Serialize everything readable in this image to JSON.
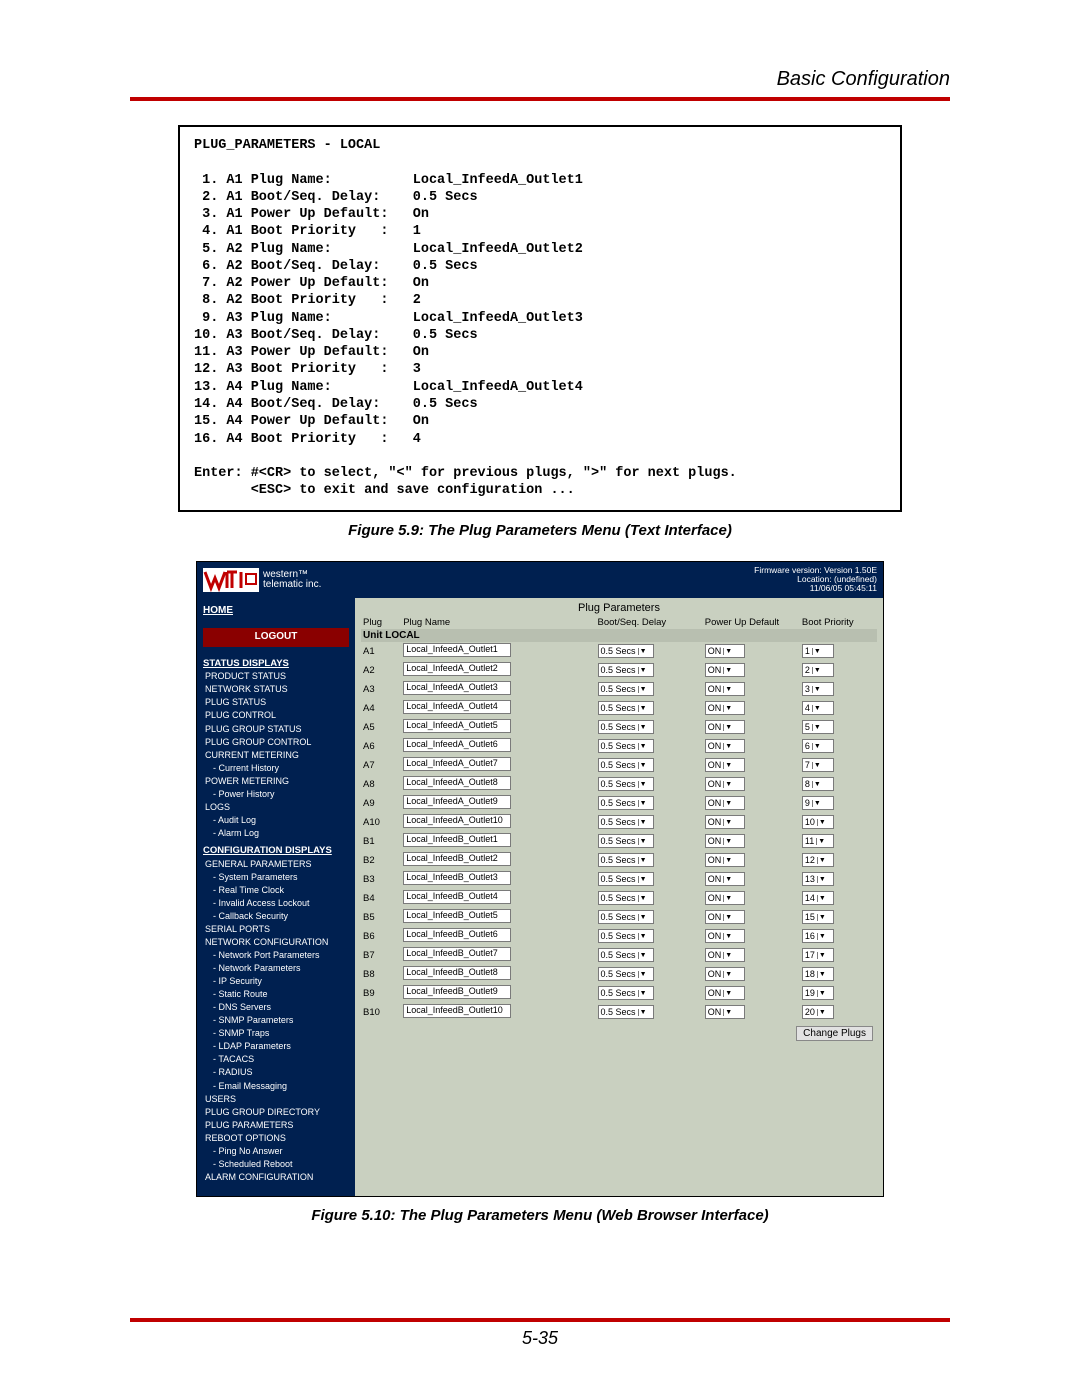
{
  "header_title": "Basic Configuration",
  "textmenu": {
    "title": "PLUG_PARAMETERS - LOCAL",
    "rows": [
      {
        "n": " 1",
        "id": "A1",
        "label": "Plug Name:",
        "val": "Local_InfeedA_Outlet1"
      },
      {
        "n": " 2",
        "id": "A1",
        "label": "Boot/Seq. Delay:",
        "val": "0.5 Secs"
      },
      {
        "n": " 3",
        "id": "A1",
        "label": "Power Up Default:",
        "val": "On"
      },
      {
        "n": " 4",
        "id": "A1",
        "label": "Boot Priority   :",
        "val": "1"
      },
      {
        "n": " 5",
        "id": "A2",
        "label": "Plug Name:",
        "val": "Local_InfeedA_Outlet2"
      },
      {
        "n": " 6",
        "id": "A2",
        "label": "Boot/Seq. Delay:",
        "val": "0.5 Secs"
      },
      {
        "n": " 7",
        "id": "A2",
        "label": "Power Up Default:",
        "val": "On"
      },
      {
        "n": " 8",
        "id": "A2",
        "label": "Boot Priority   :",
        "val": "2"
      },
      {
        "n": " 9",
        "id": "A3",
        "label": "Plug Name:",
        "val": "Local_InfeedA_Outlet3"
      },
      {
        "n": "10",
        "id": "A3",
        "label": "Boot/Seq. Delay:",
        "val": "0.5 Secs"
      },
      {
        "n": "11",
        "id": "A3",
        "label": "Power Up Default:",
        "val": "On"
      },
      {
        "n": "12",
        "id": "A3",
        "label": "Boot Priority   :",
        "val": "3"
      },
      {
        "n": "13",
        "id": "A4",
        "label": "Plug Name:",
        "val": "Local_InfeedA_Outlet4"
      },
      {
        "n": "14",
        "id": "A4",
        "label": "Boot/Seq. Delay:",
        "val": "0.5 Secs"
      },
      {
        "n": "15",
        "id": "A4",
        "label": "Power Up Default:",
        "val": "On"
      },
      {
        "n": "16",
        "id": "A4",
        "label": "Boot Priority   :",
        "val": "4"
      }
    ],
    "footer1": "Enter: #<CR> to select, \"<\" for previous plugs, \">\" for next plugs.",
    "footer2": "       <ESC> to exit and save configuration ..."
  },
  "caption1": "Figure 5.9:  The Plug Parameters Menu (Text Interface)",
  "caption2": "Figure 5.10:  The Plug Parameters Menu (Web Browser Interface)",
  "page_number": "5-35",
  "web": {
    "brand1": "western™",
    "brand2": "telematic inc.",
    "fw1": "Firmware version: Version 1.50E",
    "fw2": "Location: (undefined)",
    "fw3": "11/06/05 05:45:11",
    "home": "HOME",
    "logout": "LOGOUT",
    "nav": [
      {
        "type": "heading",
        "label": "STATUS DISPLAYS"
      },
      {
        "type": "item",
        "label": "PRODUCT STATUS"
      },
      {
        "type": "item",
        "label": "NETWORK STATUS"
      },
      {
        "type": "item",
        "label": "PLUG STATUS"
      },
      {
        "type": "item",
        "label": "PLUG CONTROL"
      },
      {
        "type": "item",
        "label": "PLUG GROUP STATUS"
      },
      {
        "type": "item",
        "label": "PLUG GROUP CONTROL"
      },
      {
        "type": "item",
        "label": "CURRENT METERING"
      },
      {
        "type": "sub",
        "label": "- Current History"
      },
      {
        "type": "item",
        "label": "POWER METERING"
      },
      {
        "type": "sub",
        "label": "- Power History"
      },
      {
        "type": "item",
        "label": "LOGS"
      },
      {
        "type": "sub",
        "label": "- Audit Log"
      },
      {
        "type": "sub",
        "label": "- Alarm Log"
      },
      {
        "type": "heading",
        "label": "CONFIGURATION DISPLAYS"
      },
      {
        "type": "item",
        "label": "GENERAL PARAMETERS"
      },
      {
        "type": "sub",
        "label": "- System Parameters"
      },
      {
        "type": "sub",
        "label": "- Real Time Clock"
      },
      {
        "type": "sub",
        "label": "- Invalid Access Lockout"
      },
      {
        "type": "sub",
        "label": "- Callback Security"
      },
      {
        "type": "item",
        "label": "SERIAL PORTS"
      },
      {
        "type": "item",
        "label": "NETWORK CONFIGURATION"
      },
      {
        "type": "sub",
        "label": "- Network Port Parameters"
      },
      {
        "type": "sub",
        "label": "- Network Parameters"
      },
      {
        "type": "sub",
        "label": "- IP Security"
      },
      {
        "type": "sub",
        "label": "- Static Route"
      },
      {
        "type": "sub",
        "label": "- DNS Servers"
      },
      {
        "type": "sub",
        "label": "- SNMP Parameters"
      },
      {
        "type": "sub",
        "label": "- SNMP Traps"
      },
      {
        "type": "sub",
        "label": "- LDAP Parameters"
      },
      {
        "type": "sub",
        "label": "- TACACS"
      },
      {
        "type": "sub",
        "label": "- RADIUS"
      },
      {
        "type": "sub",
        "label": "- Email Messaging"
      },
      {
        "type": "item",
        "label": "USERS"
      },
      {
        "type": "item",
        "label": "PLUG GROUP DIRECTORY"
      },
      {
        "type": "item",
        "label": "PLUG PARAMETERS"
      },
      {
        "type": "item",
        "label": "REBOOT OPTIONS"
      },
      {
        "type": "sub",
        "label": "- Ping No Answer"
      },
      {
        "type": "sub",
        "label": "- Scheduled Reboot"
      },
      {
        "type": "item",
        "label": "ALARM CONFIGURATION"
      }
    ],
    "table": {
      "title": "Plug Parameters",
      "hdr_plug": "Plug",
      "hdr_name": "Plug Name",
      "hdr_delay": "Boot/Seq. Delay",
      "hdr_pwr": "Power Up Default",
      "hdr_prio": "Boot Priority",
      "unit": "Unit LOCAL",
      "rows": [
        {
          "plug": "A1",
          "name": "Local_InfeedA_Outlet1",
          "delay": "0.5 Secs",
          "pwr": "ON",
          "prio": "1"
        },
        {
          "plug": "A2",
          "name": "Local_InfeedA_Outlet2",
          "delay": "0.5 Secs",
          "pwr": "ON",
          "prio": "2"
        },
        {
          "plug": "A3",
          "name": "Local_InfeedA_Outlet3",
          "delay": "0.5 Secs",
          "pwr": "ON",
          "prio": "3"
        },
        {
          "plug": "A4",
          "name": "Local_InfeedA_Outlet4",
          "delay": "0.5 Secs",
          "pwr": "ON",
          "prio": "4"
        },
        {
          "plug": "A5",
          "name": "Local_InfeedA_Outlet5",
          "delay": "0.5 Secs",
          "pwr": "ON",
          "prio": "5"
        },
        {
          "plug": "A6",
          "name": "Local_InfeedA_Outlet6",
          "delay": "0.5 Secs",
          "pwr": "ON",
          "prio": "6"
        },
        {
          "plug": "A7",
          "name": "Local_InfeedA_Outlet7",
          "delay": "0.5 Secs",
          "pwr": "ON",
          "prio": "7"
        },
        {
          "plug": "A8",
          "name": "Local_InfeedA_Outlet8",
          "delay": "0.5 Secs",
          "pwr": "ON",
          "prio": "8"
        },
        {
          "plug": "A9",
          "name": "Local_InfeedA_Outlet9",
          "delay": "0.5 Secs",
          "pwr": "ON",
          "prio": "9"
        },
        {
          "plug": "A10",
          "name": "Local_InfeedA_Outlet10",
          "delay": "0.5 Secs",
          "pwr": "ON",
          "prio": "10"
        },
        {
          "plug": "B1",
          "name": "Local_InfeedB_Outlet1",
          "delay": "0.5 Secs",
          "pwr": "ON",
          "prio": "11"
        },
        {
          "plug": "B2",
          "name": "Local_InfeedB_Outlet2",
          "delay": "0.5 Secs",
          "pwr": "ON",
          "prio": "12"
        },
        {
          "plug": "B3",
          "name": "Local_InfeedB_Outlet3",
          "delay": "0.5 Secs",
          "pwr": "ON",
          "prio": "13"
        },
        {
          "plug": "B4",
          "name": "Local_InfeedB_Outlet4",
          "delay": "0.5 Secs",
          "pwr": "ON",
          "prio": "14"
        },
        {
          "plug": "B5",
          "name": "Local_InfeedB_Outlet5",
          "delay": "0.5 Secs",
          "pwr": "ON",
          "prio": "15"
        },
        {
          "plug": "B6",
          "name": "Local_InfeedB_Outlet6",
          "delay": "0.5 Secs",
          "pwr": "ON",
          "prio": "16"
        },
        {
          "plug": "B7",
          "name": "Local_InfeedB_Outlet7",
          "delay": "0.5 Secs",
          "pwr": "ON",
          "prio": "17"
        },
        {
          "plug": "B8",
          "name": "Local_InfeedB_Outlet8",
          "delay": "0.5 Secs",
          "pwr": "ON",
          "prio": "18"
        },
        {
          "plug": "B9",
          "name": "Local_InfeedB_Outlet9",
          "delay": "0.5 Secs",
          "pwr": "ON",
          "prio": "19"
        },
        {
          "plug": "B10",
          "name": "Local_InfeedB_Outlet10",
          "delay": "0.5 Secs",
          "pwr": "ON",
          "prio": "20"
        }
      ],
      "change_btn": "Change Plugs"
    }
  }
}
